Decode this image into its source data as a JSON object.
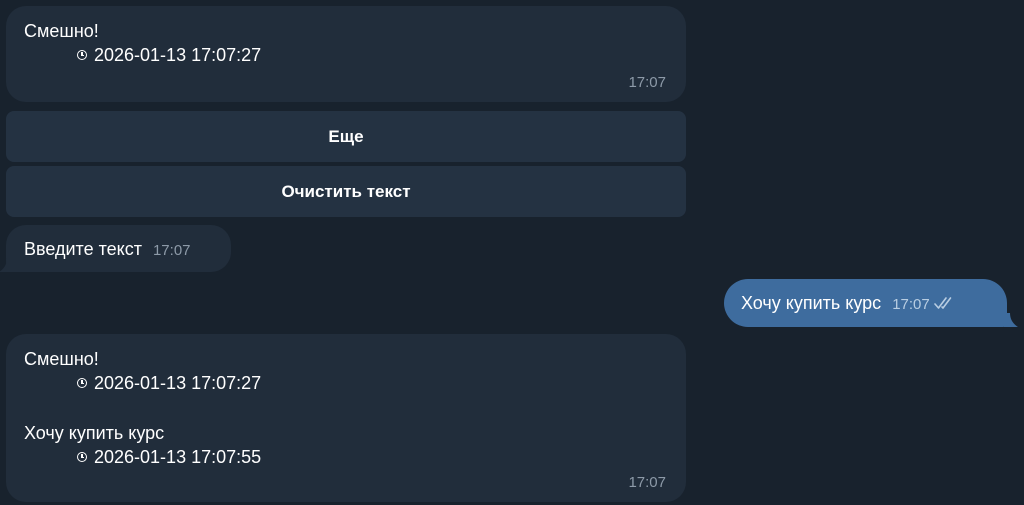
{
  "messages": [
    {
      "text": "Смешно!",
      "timestamp_line": "2026-01-13 17:07:27",
      "time": "17:07"
    },
    {
      "text": "Введите текст",
      "time": "17:07"
    },
    {
      "text": "Хочу купить курс",
      "time": "17:07"
    },
    {
      "entries": [
        {
          "text": "Смешно!",
          "timestamp_line": "2026-01-13 17:07:27"
        },
        {
          "text": "Хочу купить курс",
          "timestamp_line": "2026-01-13 17:07:55"
        }
      ],
      "time": "17:07"
    }
  ],
  "keyboard": {
    "more_label": "Еще",
    "clear_label": "Очистить текст"
  },
  "colors": {
    "background": "#18222d",
    "incoming_bubble": "#212d3b",
    "outgoing_bubble": "#3e6c9e",
    "keyboard_button": "#243242",
    "time_text": "#8d9aa8"
  }
}
